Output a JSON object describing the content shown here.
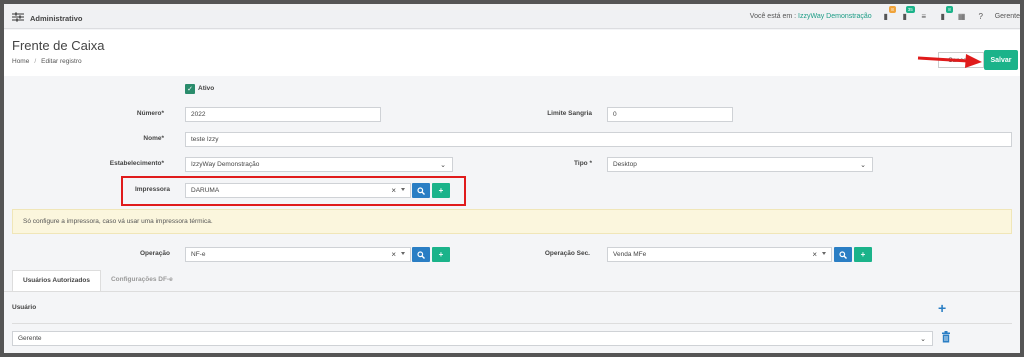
{
  "app": {
    "title": "Administrativo",
    "location_prefix": "Você está em :",
    "location_name": "IzzyWay Demonstração",
    "user": "Gerente",
    "badges": [
      "8",
      "35",
      "8"
    ]
  },
  "page": {
    "title": "Frente de Caixa",
    "breadcrumb": [
      "Home",
      "Editar registro"
    ]
  },
  "actions": {
    "cancel_label": "Cancelar",
    "save_label": "Salvar",
    "accent": "#1bb38a"
  },
  "form": {
    "ativo_label": "Ativo",
    "ativo_checked": true,
    "numero_label": "Número",
    "numero_value": "2022",
    "limite_sangria_label": "Limite Sangria",
    "limite_sangria_value": "0",
    "nome_label": "Nome",
    "nome_value": "teste Izzy",
    "estabelecimento_label": "Estabelecimento",
    "estabelecimento_value": "IzzyWay Demonstração",
    "tipo_label": "Tipo",
    "tipo_value": "Desktop",
    "impressora_label": "Impressora",
    "impressora_value": "DARUMA",
    "alert_text": "Só configure a impressora, caso vá usar uma impressora térmica.",
    "operacao_label": "Operação",
    "operacao_value": "NF-e",
    "operacao_sec_label": "Operação Sec.",
    "operacao_sec_value": "Venda MFe",
    "required_mark": "*"
  },
  "tabs": [
    {
      "label": "Usuários Autorizados",
      "active": true
    },
    {
      "label": "Configurações DF-e",
      "active": false
    }
  ],
  "users_section": {
    "column_label": "Usuário",
    "rows": [
      {
        "value": "Gerente"
      }
    ]
  }
}
